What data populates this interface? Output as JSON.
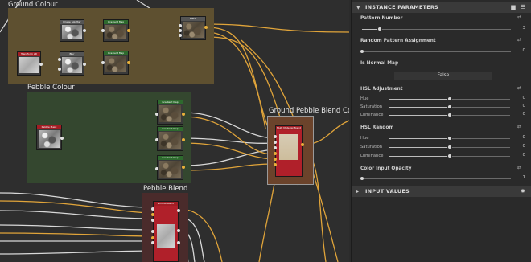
{
  "graph": {
    "frames": {
      "ground_colour": "Ground Colour",
      "pebble_colour": "Pebble Colour",
      "ground_pebble_blend": "Ground Pebble Blend Colour",
      "pebble_blend": "Pebble Blend"
    },
    "nodes": {
      "n_crop": "Image Splatter Tiler",
      "n_gradient1": "Gradient Map",
      "n_blend1": "Blend",
      "n_transform": "Transform 2D",
      "n_blur": "Blur",
      "n_gradient2": "Gradient Map",
      "n_pebble_mask": "Pebble Mask",
      "n_pgrad1": "Gradient Map",
      "n_pgrad2": "Gradient Map",
      "n_pgrad3": "Gradient Map",
      "n_multiblend": "Multi Material Blend",
      "n_normalblend": "Normal Blend"
    },
    "colors": {
      "ground_frame": "#5e5030",
      "pebble_frame": "#34472f",
      "blend_frame": "#5c3a2a",
      "wire": "#e0a43a",
      "wire_white": "#d8d8d8"
    }
  },
  "panel": {
    "instance_header": "INSTANCE PARAMETERS",
    "pattern_number": {
      "label": "Pattern Number",
      "value": "3",
      "fraction": 0.12
    },
    "random_pattern": {
      "label": "Random Pattern Assignment",
      "value": "0",
      "fraction": 0.0
    },
    "is_normal_map": {
      "label": "Is Normal Map",
      "button": "False"
    },
    "hsl_adjustment": {
      "label": "HSL Adjustment",
      "hue": {
        "label": "Hue",
        "value": "0",
        "fraction": 0.5
      },
      "saturation": {
        "label": "Saturation",
        "value": "0",
        "fraction": 0.5
      },
      "luminance": {
        "label": "Luminance",
        "value": "0",
        "fraction": 0.5
      }
    },
    "hsl_random": {
      "label": "HSL Random",
      "hue": {
        "label": "Hue",
        "value": "0",
        "fraction": 0.5
      },
      "saturation": {
        "label": "Saturation",
        "value": "0",
        "fraction": 0.5
      },
      "luminance": {
        "label": "Luminance",
        "value": "0",
        "fraction": 0.5
      }
    },
    "color_input_opacity": {
      "label": "Color Input Opacity",
      "value": "1",
      "fraction": 0.0
    },
    "input_values_header": "INPUT VALUES",
    "icons": [
      "chevron-down-icon",
      "document-icon",
      "menu-icon",
      "reset-icon",
      "gear-icon"
    ]
  }
}
